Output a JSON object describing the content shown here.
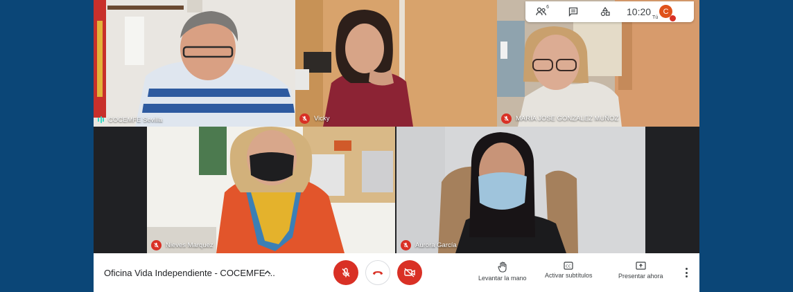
{
  "meeting": {
    "title": "Oficina Vida Independiente - COCEMFE ..."
  },
  "top_bar": {
    "participants_count": "6",
    "time": "10:20",
    "self_initial": "C",
    "self_label": "Tú",
    "icons": [
      "people-icon",
      "chat-icon",
      "activities-icon"
    ]
  },
  "participants": [
    {
      "name": "COCEMFE Sevilla",
      "state": "speaking"
    },
    {
      "name": "Vicky",
      "state": "muted"
    },
    {
      "name": "MARIA JOSE GONZALEZ MUÑOZ",
      "state": "muted"
    },
    {
      "name": "Nieves Marquez",
      "state": "muted"
    },
    {
      "name": "Aurora García",
      "state": "muted"
    }
  ],
  "controls": {
    "mic": {
      "icon": "mic-off-icon",
      "state": "off"
    },
    "hangup": {
      "icon": "phone-hangup-icon"
    },
    "camera": {
      "icon": "camera-off-icon",
      "state": "off"
    },
    "raise_hand_label": "Levantar la mano",
    "captions_label": "Activar subtítulos",
    "present_label": "Presentar ahora"
  },
  "colors": {
    "page_background": "#0b4677",
    "danger": "#d93025",
    "avatar": "#e0521b",
    "speaking": "#34d9c3"
  }
}
